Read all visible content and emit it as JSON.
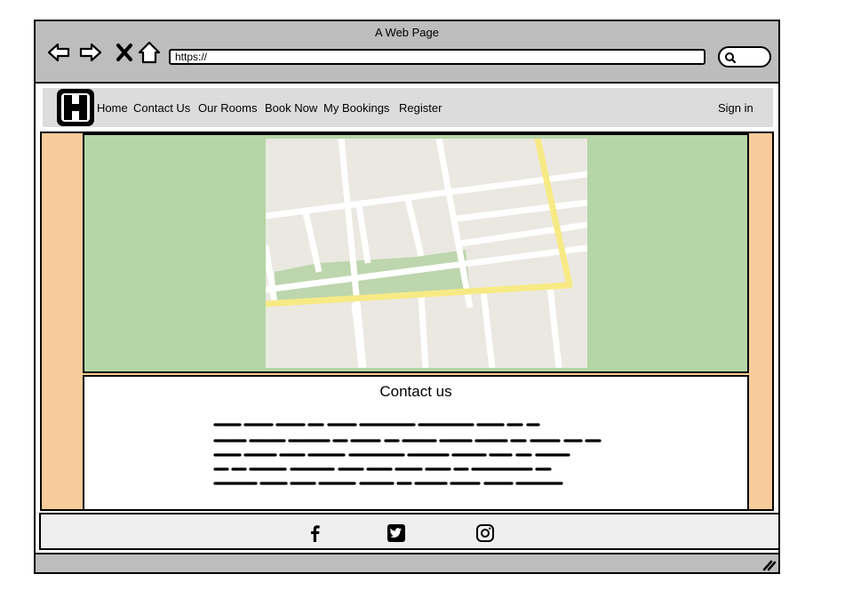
{
  "browser": {
    "title": "A Web Page",
    "url": "https://"
  },
  "site_nav": {
    "logo_letter": "H",
    "links": [
      "Home",
      "Contact Us",
      "Our Rooms",
      "Book Now",
      "My Bookings",
      "Register"
    ],
    "sign_in": "Sign in"
  },
  "contact": {
    "heading": "Contact us"
  },
  "footer": {
    "social_icons": [
      "facebook-icon",
      "twitter-icon",
      "instagram-icon"
    ]
  },
  "colors": {
    "chrome": "#bdbdbd",
    "navbar": "#dcdcdc",
    "sidebars": "#f8cb9a",
    "map_panel": "#b5d6a6",
    "map_land": "#ebe8e2",
    "map_park": "#bdd6ad",
    "map_road_main": "#f7ea84",
    "footer": "#efefef"
  }
}
